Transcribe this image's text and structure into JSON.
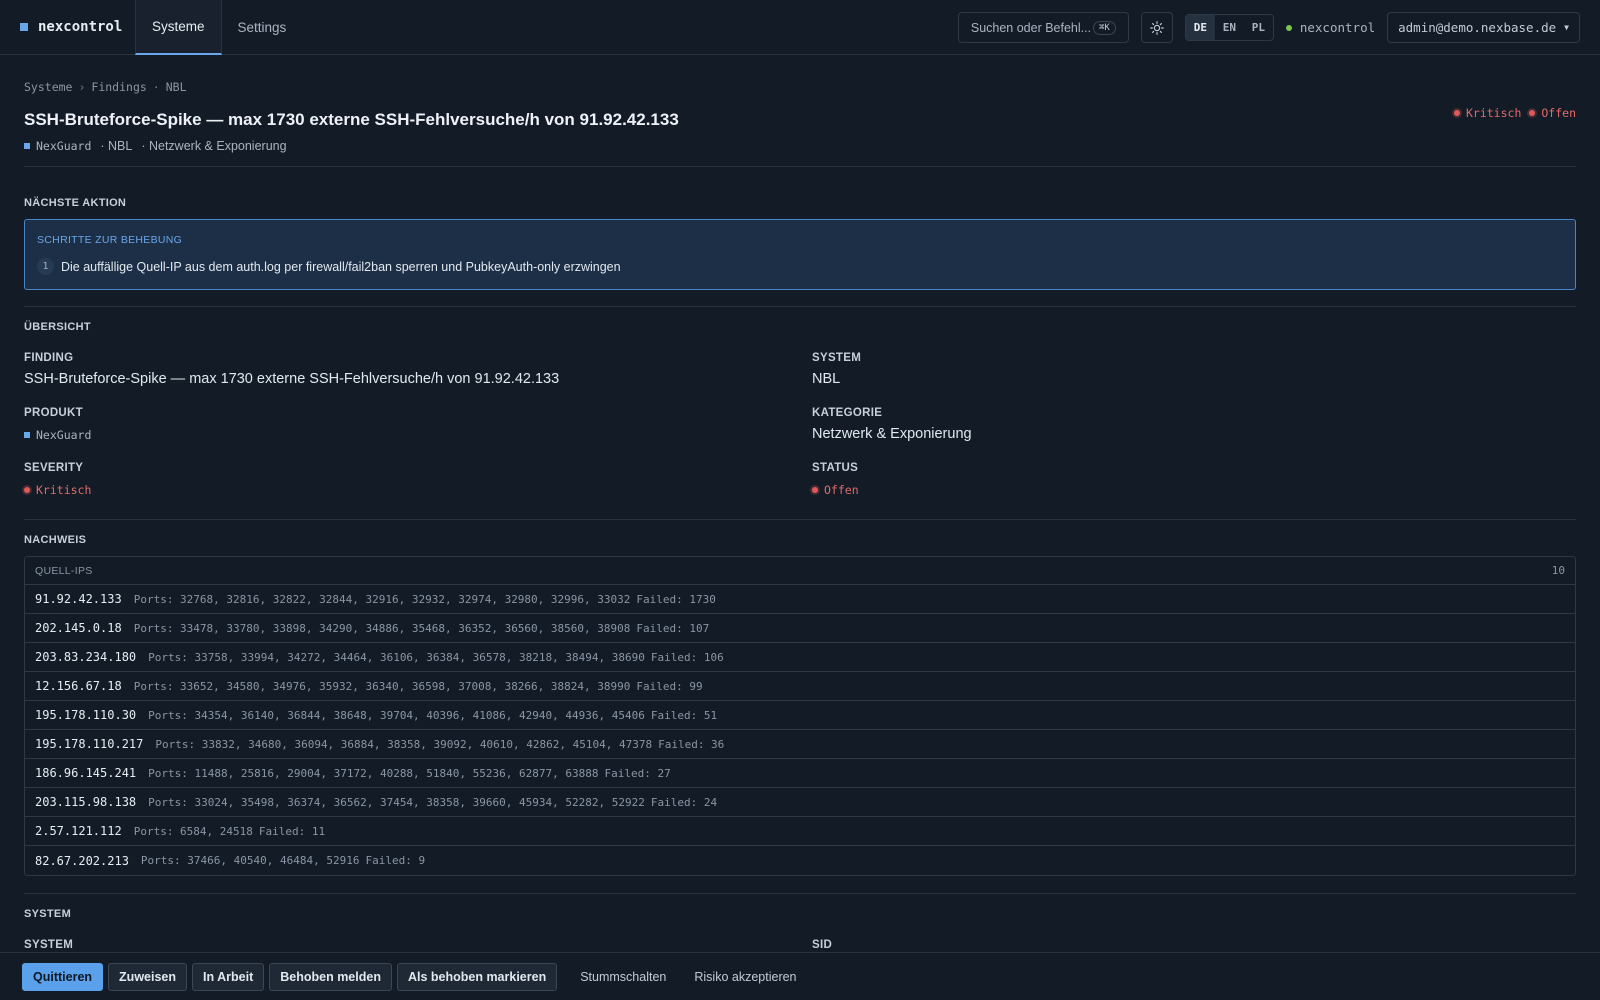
{
  "app": {
    "brand": "nexcontrol"
  },
  "nav": {
    "tabs": [
      {
        "label": "Systeme"
      },
      {
        "label": "Settings"
      }
    ]
  },
  "topbar": {
    "search_placeholder": "Suchen oder Befehl...",
    "search_shortcut": "⌘K",
    "languages": [
      "DE",
      "EN",
      "PL"
    ],
    "active_language": "DE",
    "tenant": "nexcontrol",
    "user": "admin@demo.nexbase.de",
    "status_color": "#7cc64a",
    "icons": {
      "theme": "sun-icon",
      "caret": "chevron-down-icon"
    }
  },
  "breadcrumb": [
    "Systeme",
    "Findings",
    "NBL"
  ],
  "breadcrumb_separators": [
    "›",
    "·"
  ],
  "header": {
    "title": "SSH-Bruteforce-Spike — max 1730 externe SSH-Fehlversuche/h von 91.92.42.133",
    "product": "NexGuard",
    "system": "· NBL",
    "category": "· Netzwerk & Exponierung",
    "severity": "Kritisch",
    "status": "Offen",
    "severity_color": "#e05a5a"
  },
  "next_action": {
    "heading": "NÄCHSTE AKTION",
    "box_heading": "SCHRITTE ZUR BEHEBUNG",
    "steps": [
      {
        "num": "1",
        "text": "Die auffällige Quell-IP aus dem auth.log per firewall/fail2ban sperren und PubkeyAuth-only erzwingen"
      }
    ]
  },
  "overview": {
    "heading": "ÜBERSICHT",
    "finding_label": "FINDING",
    "finding_value": "SSH-Bruteforce-Spike — max 1730 externe SSH-Fehlversuche/h von 91.92.42.133",
    "system_label": "SYSTEM",
    "system_value": "NBL",
    "product_label": "PRODUKT",
    "product_value": "NexGuard",
    "category_label": "KATEGORIE",
    "category_value": "Netzwerk & Exponierung",
    "severity_label": "SEVERITY",
    "severity_value": "Kritisch",
    "status_label": "STATUS",
    "status_value": "Offen"
  },
  "evidence": {
    "heading": "NACHWEIS",
    "table_label": "QUELL-IPS",
    "count": "10",
    "rows": [
      {
        "ip": "91.92.42.133",
        "ports": "Ports: 32768, 32816, 32822, 32844, 32916, 32932, 32974, 32980, 32996, 33032",
        "failed": "Failed: 1730"
      },
      {
        "ip": "202.145.0.18",
        "ports": "Ports: 33478, 33780, 33898, 34290, 34886, 35468, 36352, 36560, 38560, 38908",
        "failed": "Failed: 107"
      },
      {
        "ip": "203.83.234.180",
        "ports": "Ports: 33758, 33994, 34272, 34464, 36106, 36384, 36578, 38218, 38494, 38690",
        "failed": "Failed: 106"
      },
      {
        "ip": "12.156.67.18",
        "ports": "Ports: 33652, 34580, 34976, 35932, 36340, 36598, 37008, 38266, 38824, 38990",
        "failed": "Failed: 99"
      },
      {
        "ip": "195.178.110.30",
        "ports": "Ports: 34354, 36140, 36844, 38648, 39704, 40396, 41086, 42940, 44936, 45406",
        "failed": "Failed: 51"
      },
      {
        "ip": "195.178.110.217",
        "ports": "Ports: 33832, 34680, 36094, 36884, 38358, 39092, 40610, 42862, 45104, 47378",
        "failed": "Failed: 36"
      },
      {
        "ip": "186.96.145.241",
        "ports": "Ports: 11488, 25816, 29004, 37172, 40288, 51840, 55236, 62877, 63888",
        "failed": "Failed: 27"
      },
      {
        "ip": "203.115.98.138",
        "ports": "Ports: 33024, 35498, 36374, 36562, 37454, 38358, 39660, 45934, 52282, 52922",
        "failed": "Failed: 24"
      },
      {
        "ip": "2.57.121.112",
        "ports": "Ports: 6584, 24518",
        "failed": "Failed: 11"
      },
      {
        "ip": "82.67.202.213",
        "ports": "Ports: 37466, 40540, 46484, 52916",
        "failed": "Failed: 9"
      }
    ]
  },
  "system_section": {
    "heading": "SYSTEM",
    "system_label": "SYSTEM",
    "sid_label": "SID"
  },
  "actions": {
    "buttons": [
      "Quittieren",
      "Zuweisen",
      "In Arbeit",
      "Behoben melden",
      "Als behoben markieren"
    ],
    "links": [
      "Stummschalten",
      "Risiko akzeptieren"
    ]
  }
}
